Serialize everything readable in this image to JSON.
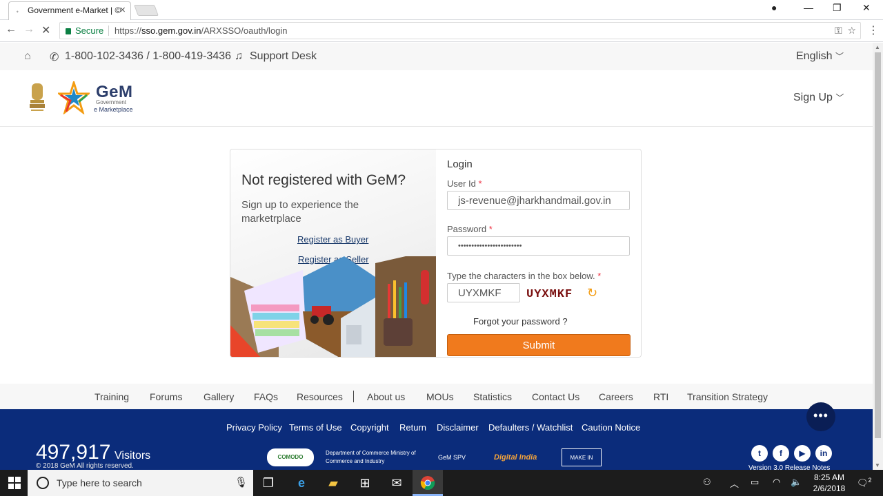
{
  "browser": {
    "tab_title": "Government e-Market | ©",
    "secure_label": "Secure",
    "url_prefix": "https://",
    "url_host": "sso.gem.gov.in",
    "url_path": "/ARXSSO/oauth/login"
  },
  "topbar": {
    "phone": "1-800-102-3436 / 1-800-419-3436",
    "support": "Support Desk",
    "language": "English"
  },
  "header": {
    "brand": "GeM",
    "brand_sub1": "Government",
    "brand_sub2": "e Marketplace",
    "signup": "Sign Up"
  },
  "promo": {
    "heading": "Not registered with GeM?",
    "subtext": "Sign up to experience the marketrplace",
    "register_buyer": "Register as Buyer",
    "register_seller": "Register as Seller"
  },
  "login": {
    "title": "Login",
    "userid_label": "User Id",
    "userid_value": "js-revenue@jharkhandmail.gov.in",
    "password_label": "Password",
    "password_value": "••••••••••••••••••••••••",
    "captcha_label": "Type the characters in the box below.",
    "required_mark": "*",
    "captcha_input": "UYXMKF",
    "captcha_image_text": "UYXMKF",
    "forgot": "Forgot your password ?",
    "submit": "Submit"
  },
  "footer_nav": [
    "Training",
    "Forums",
    "Gallery",
    "FAQs",
    "Resources",
    "About us",
    "MOUs",
    "Statistics",
    "Contact Us",
    "Careers",
    "RTI",
    "Transition Strategy"
  ],
  "footer": {
    "policies": [
      "Privacy Policy",
      "Terms of Use",
      "Copyright",
      "Return",
      "Disclaimer",
      "Defaulters / Watchlist",
      "Caution Notice"
    ],
    "visitors_count": "497,917",
    "visitors_label": "Visitors",
    "copyright": "© 2018 GeM All rights reserved.",
    "version": "Version 3.0 Release Notes",
    "partners": [
      "COMODO SECURE",
      "Department of Commerce Ministry of Commerce and Industry",
      "GeM SPV",
      "Digital India",
      "MAKE IN INDIA"
    ],
    "social": [
      "twitter-icon",
      "facebook-icon",
      "youtube-icon",
      "linkedin-icon"
    ]
  },
  "taskbar": {
    "search_placeholder": "Type here to search",
    "time": "8:25 AM",
    "date": "2/6/2018",
    "notifications": "2"
  },
  "colors": {
    "accent_orange": "#f07a1d",
    "footer_blue": "#0b2c7b",
    "secure_green": "#0b8043"
  }
}
